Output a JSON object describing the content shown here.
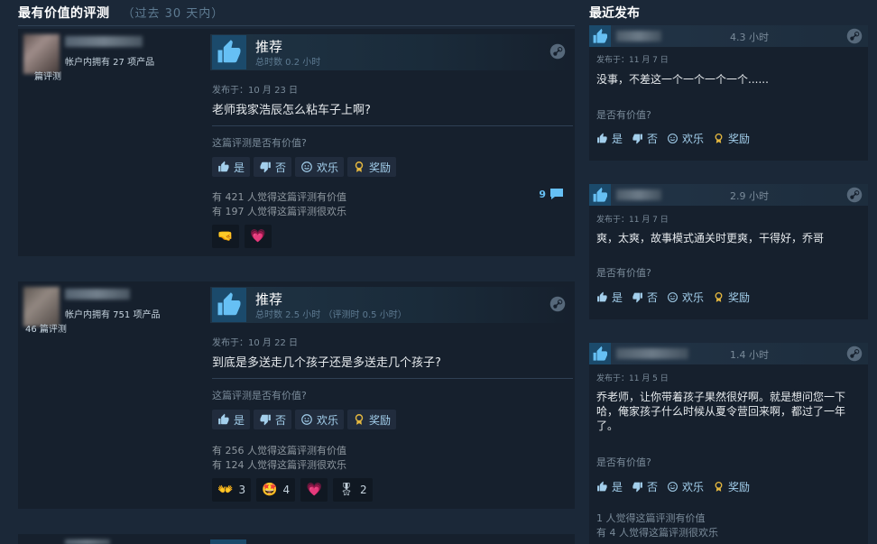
{
  "left": {
    "title": "最有价值的评测",
    "subtitle": "（过去 30 天内）",
    "reviews": [
      {
        "products": "帐户内拥有 27 项产品",
        "reviews_count": "篇评测",
        "verdict": "推荐",
        "hours": "总时数 0.2 小时",
        "posted": "发布于：10 月 23 日",
        "text": "老师我家浩辰怎么粘车子上啊?",
        "helpful_q": "这篇评测是否有价值?",
        "buttons": {
          "yes": "是",
          "no": "否",
          "funny": "欢乐",
          "award": "奖励"
        },
        "stat_helpful": "有 421 人觉得这篇评测有价值",
        "stat_funny": "有 197 人觉得这篇评测很欢乐",
        "comments": "9",
        "awards": [
          {
            "icon": "🤜",
            "count": ""
          },
          {
            "icon": "💗",
            "count": ""
          }
        ]
      },
      {
        "products": "帐户内拥有 751 项产品",
        "reviews_count": "46 篇评测",
        "verdict": "推荐",
        "hours": "总时数 2.5 小时  （评测时 0.5 小时）",
        "posted": "发布于：10 月 22 日",
        "text": "到底是多送走几个孩子还是多送走几个孩子?",
        "helpful_q": "这篇评测是否有价值?",
        "buttons": {
          "yes": "是",
          "no": "否",
          "funny": "欢乐",
          "award": "奖励"
        },
        "stat_helpful": "有 256 人觉得这篇评测有价值",
        "stat_funny": "有 124 人觉得这篇评测很欢乐",
        "comments": "",
        "awards": [
          {
            "icon": "👐",
            "count": "3"
          },
          {
            "icon": "🤩",
            "count": "4"
          },
          {
            "icon": "💗",
            "count": ""
          },
          {
            "icon": "🎖",
            "count": "2"
          }
        ]
      }
    ]
  },
  "right": {
    "title": "最近发布",
    "reviews": [
      {
        "hours": "4.3 小时",
        "posted": "发布于：11 月 7 日",
        "text": "没事，不差这一个一个一个一个......",
        "helpful_q": "是否有价值?",
        "buttons": {
          "yes": "是",
          "no": "否",
          "funny": "欢乐",
          "award": "奖励"
        },
        "stat_helpful": "",
        "stat_funny": ""
      },
      {
        "hours": "2.9 小时",
        "posted": "发布于：11 月 7 日",
        "text": "爽，太爽，故事模式通关时更爽，干得好，乔哥",
        "helpful_q": "是否有价值?",
        "buttons": {
          "yes": "是",
          "no": "否",
          "funny": "欢乐",
          "award": "奖励"
        },
        "stat_helpful": "",
        "stat_funny": ""
      },
      {
        "hours": "1.4 小时",
        "posted": "发布于：11 月 5 日",
        "text": "乔老师，让你带着孩子果然很好啊。就是想问您一下哈，俺家孩子什么时候从夏令营回来啊，都过了一年了。",
        "helpful_q": "是否有价值?",
        "buttons": {
          "yes": "是",
          "no": "否",
          "funny": "欢乐",
          "award": "奖励"
        },
        "stat_helpful": "1 人觉得这篇评测有价值",
        "stat_funny": "有 4 人觉得这篇评测很欢乐"
      }
    ]
  },
  "colors": {
    "background": "#1b2838",
    "accent": "#66c0f4",
    "thumb_bg": "#1b4a6b"
  }
}
